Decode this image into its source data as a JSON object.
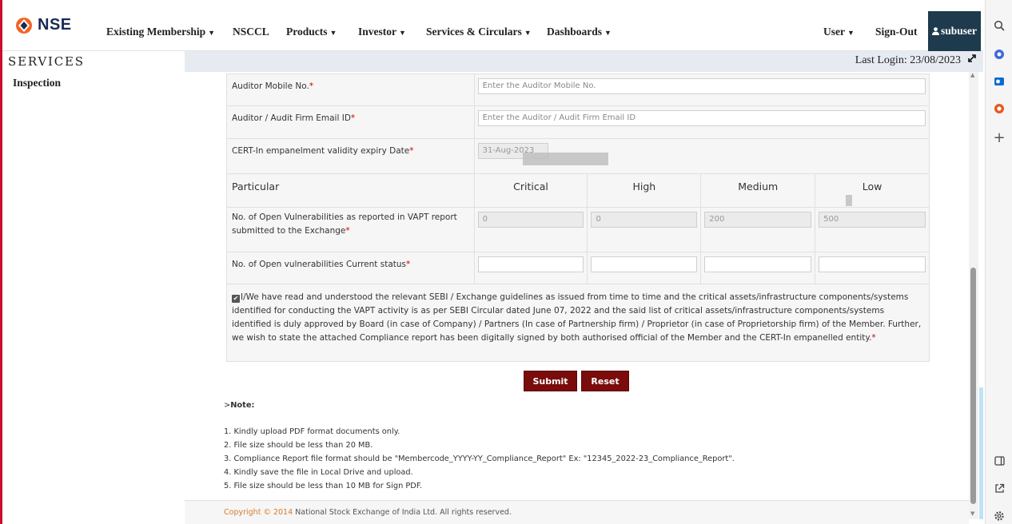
{
  "brand": {
    "logo_text": "NSE"
  },
  "nav": {
    "items": [
      {
        "label": "Existing Membership",
        "caret": "▼"
      },
      {
        "label": "NSCCL",
        "caret": ""
      },
      {
        "label": "Products",
        "caret": "▼"
      },
      {
        "label": "Investor",
        "caret": "▼"
      },
      {
        "label": "Services & Circulars",
        "caret": "▼"
      },
      {
        "label": "Dashboards",
        "caret": "▼"
      }
    ],
    "user": {
      "label": "User",
      "caret": "▼"
    },
    "signout": "Sign-Out",
    "account": "subuser"
  },
  "section_title": "SERVICES",
  "left_menu": {
    "active": "Inspection"
  },
  "last_login": "Last Login: 23/08/2023",
  "form": {
    "auditor_mobile": {
      "label": "Auditor Mobile No.",
      "placeholder": "Enter the Auditor Mobile No."
    },
    "auditor_email": {
      "label": "Auditor / Audit Firm Email ID",
      "placeholder": "Enter the Auditor / Audit Firm Email ID"
    },
    "cert_date": {
      "label": "CERT-In empanelment validity expiry Date",
      "value": "31-Aug-2023"
    },
    "required_mark": "*",
    "severity_header": {
      "particular": "Particular",
      "critical": "Critical",
      "high": "High",
      "medium": "Medium",
      "low": "Low"
    },
    "vapt_row": {
      "label": "No. of Open Vulnerabilities as reported in VAPT report submitted to the Exchange",
      "critical": "0",
      "high": "0",
      "medium": "200",
      "low": "500"
    },
    "current_row": {
      "label": "No. of Open vulnerabilities Current status",
      "critical": "",
      "high": "",
      "medium": "",
      "low": ""
    },
    "declaration": {
      "checked": true,
      "text": "I/We have read and understood the relevant SEBI / Exchange guidelines as issued from time to time and the critical assets/infrastructure components/systems identified for conducting the VAPT activity is as per SEBI Circular dated June 07, 2022 and the said list of critical assets/infrastructure components/systems identified is duly approved by Board (in case of Company) / Partners (In case of Partnership firm) / Proprietor (in case of Proprietorship firm) of the Member. Further, we wish to state the attached Compliance report has been digitally signed by both authorised official of the Member and the CERT-In empanelled entity."
    },
    "submit_label": "Submit",
    "reset_label": "Reset"
  },
  "note": {
    "heading_prefix": ">",
    "heading": "Note:",
    "items": [
      "1. Kindly upload PDF format documents only.",
      "2. File size should be less than 20 MB.",
      "3. Compliance Report file format should be \"Membercode_YYYY-YY_Compliance_Report\" Ex: \"12345_2022-23_Compliance_Report\".",
      "4. Kindly save the file in Local Drive and upload.",
      "5. File size should be less than 10 MB for Sign PDF."
    ]
  },
  "footer": {
    "brand": "Copyright © 2014",
    "rest": "National Stock Exchange of India Ltd. All rights reserved."
  },
  "colors": {
    "accent": "#7a0c0c",
    "nav_account_bg": "#1e3a4d",
    "left_border": "#c8102e"
  },
  "browser_sidebar_icons": [
    "search-icon",
    "copilot-icon",
    "outlook-icon",
    "office-icon",
    "add-icon",
    "sidebar-toggle-icon",
    "external-link-icon",
    "settings-icon"
  ]
}
